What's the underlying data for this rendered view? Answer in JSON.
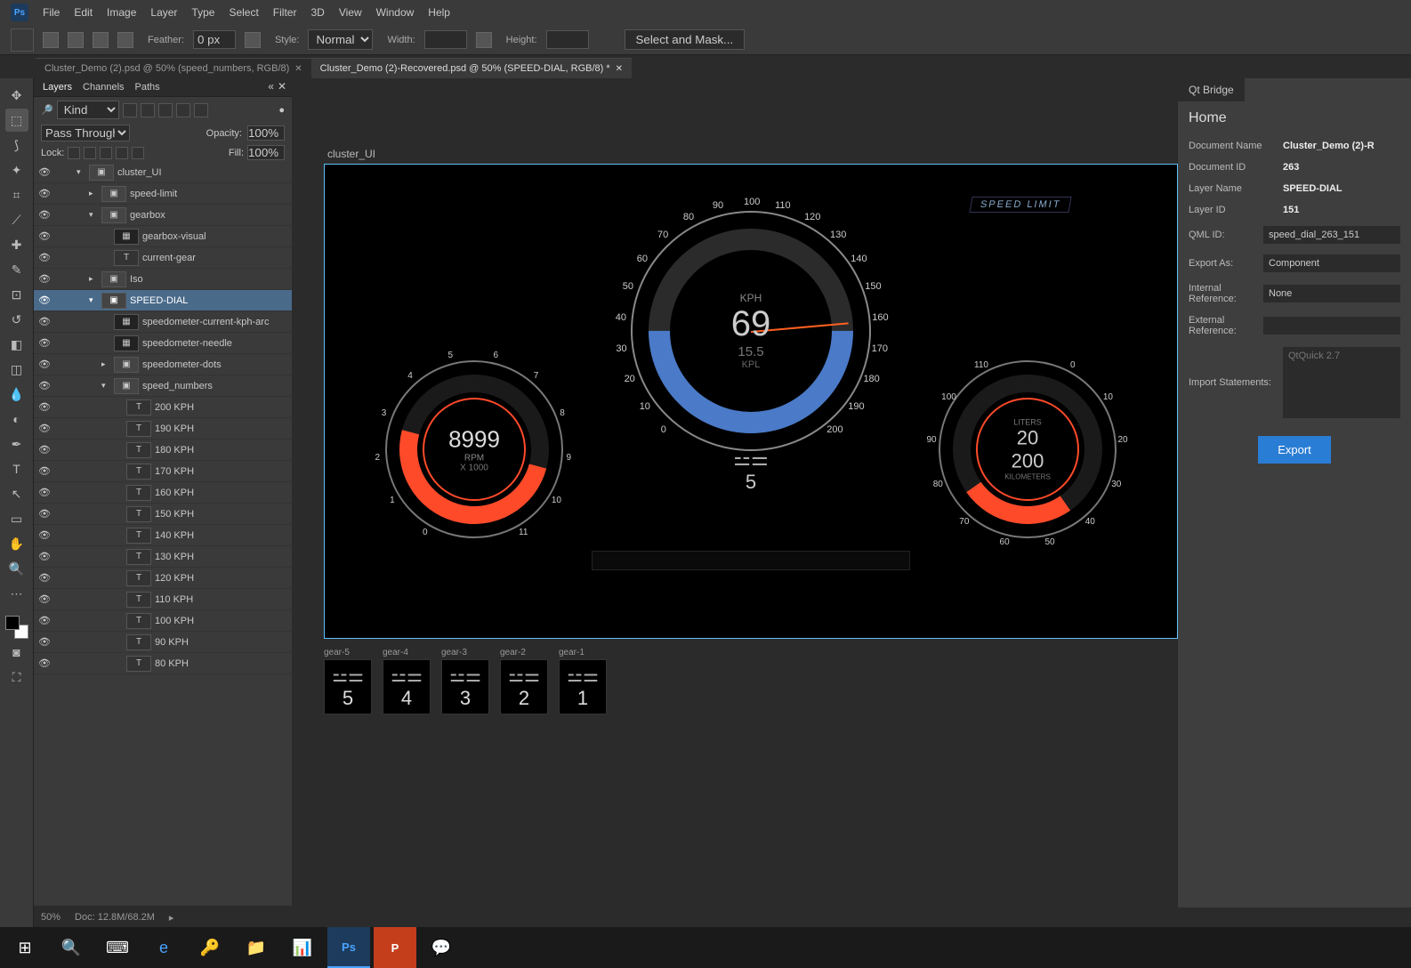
{
  "menubar": [
    "File",
    "Edit",
    "Image",
    "Layer",
    "Type",
    "Select",
    "Filter",
    "3D",
    "View",
    "Window",
    "Help"
  ],
  "optbar": {
    "feather_label": "Feather:",
    "feather_value": "0 px",
    "style_label": "Style:",
    "style_value": "Normal",
    "width_label": "Width:",
    "height_label": "Height:",
    "mask_button": "Select and Mask..."
  },
  "tabs": [
    {
      "title": "Cluster_Demo (2).psd @ 50% (speed_numbers, RGB/8)",
      "active": false
    },
    {
      "title": "Cluster_Demo (2)-Recovered.psd @ 50% (SPEED-DIAL, RGB/8) *",
      "active": true
    }
  ],
  "layers_panel": {
    "tabs": [
      "Layers",
      "Channels",
      "Paths"
    ],
    "filter_kind": "Kind",
    "blend_mode": "Pass Through",
    "opacity_label": "Opacity:",
    "opacity_value": "100%",
    "lock_label": "Lock:",
    "fill_label": "Fill:",
    "fill_value": "100%",
    "items": [
      {
        "indent": 0,
        "type": "folder",
        "chev": "▾",
        "name": "cluster_UI",
        "selected": false
      },
      {
        "indent": 1,
        "type": "folder",
        "chev": "▸",
        "name": "speed-limit",
        "selected": false
      },
      {
        "indent": 1,
        "type": "folder",
        "chev": "▾",
        "name": "gearbox",
        "selected": false
      },
      {
        "indent": 2,
        "type": "visual",
        "chev": "",
        "name": "gearbox-visual",
        "selected": false
      },
      {
        "indent": 2,
        "type": "text",
        "chev": "",
        "name": "current-gear",
        "selected": false
      },
      {
        "indent": 1,
        "type": "folder",
        "chev": "▸",
        "name": "Iso",
        "selected": false
      },
      {
        "indent": 1,
        "type": "folder",
        "chev": "▾",
        "name": "SPEED-DIAL",
        "selected": true
      },
      {
        "indent": 2,
        "type": "visual",
        "chev": "",
        "name": "speedometer-current-kph-arc",
        "selected": false
      },
      {
        "indent": 2,
        "type": "visual",
        "chev": "",
        "name": "speedometer-needle",
        "selected": false
      },
      {
        "indent": 2,
        "type": "folder",
        "chev": "▸",
        "name": "speedometer-dots",
        "selected": false
      },
      {
        "indent": 2,
        "type": "folder",
        "chev": "▾",
        "name": "speed_numbers",
        "selected": false
      },
      {
        "indent": 3,
        "type": "text",
        "chev": "",
        "name": "200 KPH",
        "selected": false
      },
      {
        "indent": 3,
        "type": "text",
        "chev": "",
        "name": "190 KPH",
        "selected": false
      },
      {
        "indent": 3,
        "type": "text",
        "chev": "",
        "name": "180 KPH",
        "selected": false
      },
      {
        "indent": 3,
        "type": "text",
        "chev": "",
        "name": "170 KPH",
        "selected": false
      },
      {
        "indent": 3,
        "type": "text",
        "chev": "",
        "name": "160 KPH",
        "selected": false
      },
      {
        "indent": 3,
        "type": "text",
        "chev": "",
        "name": "150 KPH",
        "selected": false
      },
      {
        "indent": 3,
        "type": "text",
        "chev": "",
        "name": "140 KPH",
        "selected": false
      },
      {
        "indent": 3,
        "type": "text",
        "chev": "",
        "name": "130 KPH",
        "selected": false
      },
      {
        "indent": 3,
        "type": "text",
        "chev": "",
        "name": "120 KPH",
        "selected": false
      },
      {
        "indent": 3,
        "type": "text",
        "chev": "",
        "name": "110 KPH",
        "selected": false
      },
      {
        "indent": 3,
        "type": "text",
        "chev": "",
        "name": "100 KPH",
        "selected": false
      },
      {
        "indent": 3,
        "type": "text",
        "chev": "",
        "name": "90 KPH",
        "selected": false
      },
      {
        "indent": 3,
        "type": "text",
        "chev": "",
        "name": "80 KPH",
        "selected": false
      }
    ]
  },
  "canvas": {
    "artboard_label": "cluster_UI",
    "speed_limit_label": "SPEED LIMIT",
    "speed": {
      "unit": "KPH",
      "value": "69",
      "economy_value": "15.5",
      "economy_unit": "KPL",
      "ticks": [
        "0",
        "10",
        "20",
        "30",
        "40",
        "50",
        "60",
        "70",
        "80",
        "90",
        "100",
        "110",
        "120",
        "130",
        "140",
        "150",
        "160",
        "170",
        "180",
        "190",
        "200"
      ]
    },
    "gear": {
      "icon": "⚙",
      "value": "5"
    },
    "rpm": {
      "value": "8999",
      "unit": "RPM",
      "unit2": "X 1000",
      "ticks": [
        "0",
        "1",
        "2",
        "3",
        "4",
        "5",
        "6",
        "7",
        "8",
        "9",
        "10",
        "11"
      ]
    },
    "fuel": {
      "lbl_top": "LITERS",
      "val_top": "20",
      "val_bot": "200",
      "lbl_bot": "KILOMETERS",
      "ticks": [
        "0",
        "10",
        "20",
        "30",
        "40",
        "50",
        "60",
        "70",
        "80",
        "90",
        "100",
        "110"
      ]
    },
    "assets": [
      {
        "label": "gear-5",
        "num": "5"
      },
      {
        "label": "gear-4",
        "num": "4"
      },
      {
        "label": "gear-3",
        "num": "3"
      },
      {
        "label": "gear-2",
        "num": "2"
      },
      {
        "label": "gear-1",
        "num": "1"
      }
    ]
  },
  "rightpanel": {
    "tab": "Qt Bridge",
    "title": "Home",
    "rows": [
      {
        "label": "Document Name",
        "value": "Cluster_Demo (2)-R",
        "type": "text"
      },
      {
        "label": "Document ID",
        "value": "263",
        "type": "text"
      },
      {
        "label": "Layer Name",
        "value": "SPEED-DIAL",
        "type": "text"
      },
      {
        "label": "Layer ID",
        "value": "151",
        "type": "text"
      },
      {
        "label": "QML ID:",
        "value": "speed_dial_263_151",
        "type": "input"
      },
      {
        "label": "Export As:",
        "value": "Component",
        "type": "input"
      },
      {
        "label": "Internal Reference:",
        "value": "None",
        "type": "input"
      },
      {
        "label": "External Reference:",
        "value": "",
        "type": "input"
      },
      {
        "label": "Import Statements:",
        "value": "QtQuick 2.7",
        "type": "textarea"
      }
    ],
    "export_button": "Export"
  },
  "statusbar": {
    "zoom": "50%",
    "doc": "Doc: 12.8M/68.2M"
  },
  "taskbar": [
    "⊞",
    "🔍",
    "⌨",
    "e",
    "🔑",
    "📁",
    "📊",
    "Ps",
    "P",
    "💬"
  ]
}
